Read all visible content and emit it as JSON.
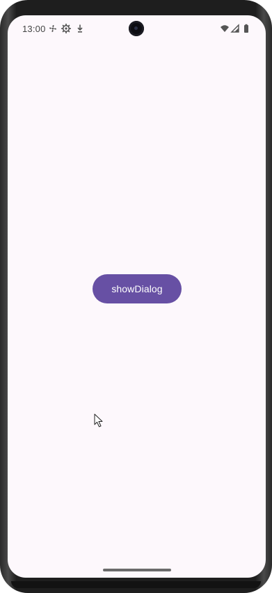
{
  "status_bar": {
    "time": "13:00",
    "left_icons": [
      "fan-icon",
      "settings-gear-icon",
      "download-icon"
    ],
    "right_icons": [
      "wifi-icon",
      "signal-icon",
      "battery-icon"
    ]
  },
  "main": {
    "show_dialog_label": "showDialog"
  },
  "colors": {
    "primary": "#6750a4",
    "background": "#fdf8fc",
    "on_primary": "#ffffff"
  }
}
